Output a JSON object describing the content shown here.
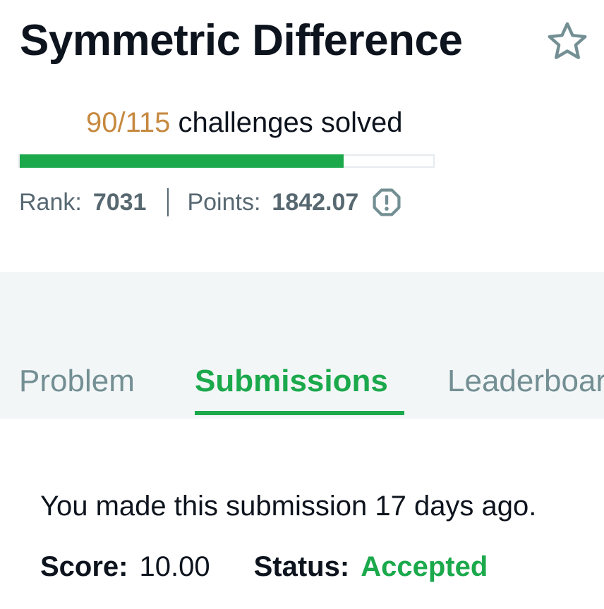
{
  "header": {
    "title": "Symmetric Difference",
    "favorite_icon": "star-icon"
  },
  "progress": {
    "solved_count": "90/115",
    "solved_label": "challenges solved",
    "solved": 90,
    "total": 115
  },
  "stats": {
    "rank_label": "Rank:",
    "rank_value": "7031",
    "points_label": "Points:",
    "points_value": "1842.07",
    "info_icon": "exclamation-circle-icon"
  },
  "tabs": [
    {
      "label": "Problem",
      "active": false
    },
    {
      "label": "Submissions",
      "active": true
    },
    {
      "label": "Leaderboard",
      "active": false
    }
  ],
  "submission": {
    "message": "You made this submission 17 days ago.",
    "score_label": "Score:",
    "score_value": "10.00",
    "status_label": "Status:",
    "status_value": "Accepted"
  },
  "colors": {
    "accent_green": "#1ba94c",
    "count_orange": "#c6893f",
    "muted_gray": "#576871",
    "tab_gray": "#738f93",
    "band_bg": "#f3f6f7"
  }
}
